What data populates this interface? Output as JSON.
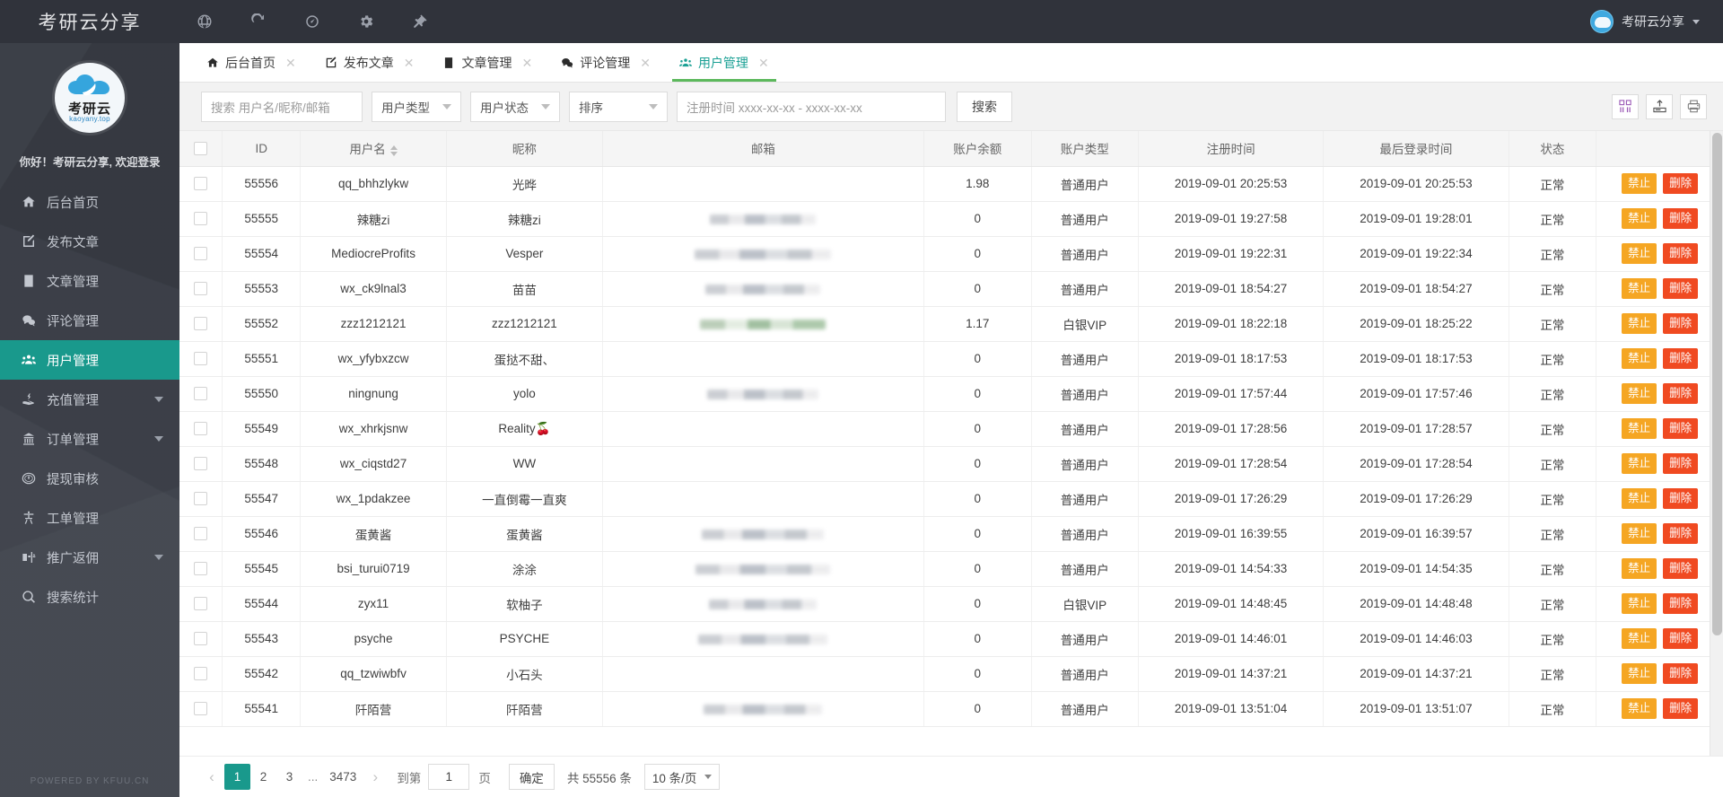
{
  "topbar": {
    "brand": "考研云分享",
    "icons": [
      "globe-icon",
      "refresh-icon",
      "dashboard-icon",
      "gear-icon",
      "pin-icon"
    ],
    "user": "考研云分享"
  },
  "sidebar": {
    "logo_cn": "考研云",
    "logo_url": "kaoyany.top",
    "greeting": "你好！考研云分享, 欢迎登录",
    "powered": "POWERED BY KFUU.CN",
    "items": [
      {
        "label": "后台首页",
        "icon": "home-icon",
        "active": false,
        "arrow": false
      },
      {
        "label": "发布文章",
        "icon": "edit-icon",
        "active": false,
        "arrow": false
      },
      {
        "label": "文章管理",
        "icon": "doc-icon",
        "active": false,
        "arrow": false
      },
      {
        "label": "评论管理",
        "icon": "comment-icon",
        "active": false,
        "arrow": false
      },
      {
        "label": "用户管理",
        "icon": "users-icon",
        "active": true,
        "arrow": false
      },
      {
        "label": "充值管理",
        "icon": "recharge-icon",
        "active": false,
        "arrow": true
      },
      {
        "label": "订单管理",
        "icon": "order-icon",
        "active": false,
        "arrow": true
      },
      {
        "label": "提现审核",
        "icon": "withdraw-icon",
        "active": false,
        "arrow": false
      },
      {
        "label": "工单管理",
        "icon": "ticket-icon",
        "active": false,
        "arrow": false
      },
      {
        "label": "推广返佣",
        "icon": "promote-icon",
        "active": false,
        "arrow": true
      },
      {
        "label": "搜索统计",
        "icon": "search-icon",
        "active": false,
        "arrow": false
      }
    ]
  },
  "tabs": [
    {
      "label": "后台首页",
      "icon": "home-icon",
      "active": false
    },
    {
      "label": "发布文章",
      "icon": "edit-icon",
      "active": false
    },
    {
      "label": "文章管理",
      "icon": "doc-icon",
      "active": false
    },
    {
      "label": "评论管理",
      "icon": "comment-icon",
      "active": false
    },
    {
      "label": "用户管理",
      "icon": "users-icon",
      "active": true
    }
  ],
  "toolbar": {
    "search_placeholder": "搜索 用户名/昵称/邮箱",
    "search_value": "",
    "user_type": "用户类型",
    "user_status": "用户状态",
    "sort": "排序",
    "date_placeholder": "注册时间 xxxx-xx-xx - xxxx-xx-xx",
    "date_value": "",
    "search_button": "搜索",
    "right_icons": [
      "columns-icon",
      "export-icon",
      "print-icon"
    ]
  },
  "table": {
    "columns": [
      "",
      "ID",
      "用户名",
      "昵称",
      "邮箱",
      "账户余额",
      "账户类型",
      "注册时间",
      "最后登录时间",
      "状态",
      ""
    ],
    "sortable_column": "用户名",
    "ban_label": "禁止",
    "delete_label": "删除",
    "rows": [
      {
        "id": "55556",
        "username": "qq_bhhzlykw",
        "nickname": "光晔",
        "mail_w": 0,
        "mail_green": false,
        "balance": "1.98",
        "type": "普通用户",
        "reg": "2019-09-01 20:25:53",
        "login": "2019-09-01 20:25:53",
        "status": "正常"
      },
      {
        "id": "55555",
        "username": "辣糖zi",
        "nickname": "辣糖zi",
        "mail_w": 118,
        "mail_green": false,
        "balance": "0",
        "type": "普通用户",
        "reg": "2019-09-01 19:27:58",
        "login": "2019-09-01 19:28:01",
        "status": "正常"
      },
      {
        "id": "55554",
        "username": "MediocreProfits",
        "nickname": "Vesper",
        "mail_w": 152,
        "mail_green": false,
        "balance": "0",
        "type": "普通用户",
        "reg": "2019-09-01 19:22:31",
        "login": "2019-09-01 19:22:34",
        "status": "正常"
      },
      {
        "id": "55553",
        "username": "wx_ck9lnal3",
        "nickname": "苗苗",
        "mail_w": 128,
        "mail_green": false,
        "balance": "0",
        "type": "普通用户",
        "reg": "2019-09-01 18:54:27",
        "login": "2019-09-01 18:54:27",
        "status": "正常"
      },
      {
        "id": "55552",
        "username": "zzz1212121",
        "nickname": "zzz1212121",
        "mail_w": 140,
        "mail_green": true,
        "balance": "1.17",
        "type": "白银VIP",
        "reg": "2019-09-01 18:22:18",
        "login": "2019-09-01 18:25:22",
        "status": "正常"
      },
      {
        "id": "55551",
        "username": "wx_yfybxzcw",
        "nickname": "蛋挞不甜、",
        "mail_w": 0,
        "mail_green": false,
        "balance": "0",
        "type": "普通用户",
        "reg": "2019-09-01 18:17:53",
        "login": "2019-09-01 18:17:53",
        "status": "正常"
      },
      {
        "id": "55550",
        "username": "ningnung",
        "nickname": "yolo",
        "mail_w": 124,
        "mail_green": false,
        "balance": "0",
        "type": "普通用户",
        "reg": "2019-09-01 17:57:44",
        "login": "2019-09-01 17:57:46",
        "status": "正常"
      },
      {
        "id": "55549",
        "username": "wx_xhrkjsnw",
        "nickname": "Reality🍒",
        "mail_w": 0,
        "mail_green": false,
        "balance": "0",
        "type": "普通用户",
        "reg": "2019-09-01 17:28:56",
        "login": "2019-09-01 17:28:57",
        "status": "正常"
      },
      {
        "id": "55548",
        "username": "wx_ciqstd27",
        "nickname": "WW",
        "mail_w": 0,
        "mail_green": false,
        "balance": "0",
        "type": "普通用户",
        "reg": "2019-09-01 17:28:54",
        "login": "2019-09-01 17:28:54",
        "status": "正常"
      },
      {
        "id": "55547",
        "username": "wx_1pdakzee",
        "nickname": "一直倒霉一直爽",
        "mail_w": 0,
        "mail_green": false,
        "balance": "0",
        "type": "普通用户",
        "reg": "2019-09-01 17:26:29",
        "login": "2019-09-01 17:26:29",
        "status": "正常"
      },
      {
        "id": "55546",
        "username": "蛋黄酱",
        "nickname": "蛋黄酱",
        "mail_w": 136,
        "mail_green": false,
        "balance": "0",
        "type": "普通用户",
        "reg": "2019-09-01 16:39:55",
        "login": "2019-09-01 16:39:57",
        "status": "正常"
      },
      {
        "id": "55545",
        "username": "bsi_turui0719",
        "nickname": "涂涂",
        "mail_w": 150,
        "mail_green": false,
        "balance": "0",
        "type": "普通用户",
        "reg": "2019-09-01 14:54:33",
        "login": "2019-09-01 14:54:35",
        "status": "正常"
      },
      {
        "id": "55544",
        "username": "zyx11",
        "nickname": "软柚子",
        "mail_w": 120,
        "mail_green": false,
        "balance": "0",
        "type": "白银VIP",
        "reg": "2019-09-01 14:48:45",
        "login": "2019-09-01 14:48:48",
        "status": "正常"
      },
      {
        "id": "55543",
        "username": "psyche",
        "nickname": "PSYCHE",
        "mail_w": 144,
        "mail_green": false,
        "balance": "0",
        "type": "普通用户",
        "reg": "2019-09-01 14:46:01",
        "login": "2019-09-01 14:46:03",
        "status": "正常"
      },
      {
        "id": "55542",
        "username": "qq_tzwiwbfv",
        "nickname": "小石头",
        "mail_w": 0,
        "mail_green": false,
        "balance": "0",
        "type": "普通用户",
        "reg": "2019-09-01 14:37:21",
        "login": "2019-09-01 14:37:21",
        "status": "正常"
      },
      {
        "id": "55541",
        "username": "阡陌营",
        "nickname": "阡陌营",
        "mail_w": 132,
        "mail_green": false,
        "balance": "0",
        "type": "普通用户",
        "reg": "2019-09-01 13:51:04",
        "login": "2019-09-01 13:51:07",
        "status": "正常"
      }
    ]
  },
  "pagination": {
    "pages": [
      "1",
      "2",
      "3"
    ],
    "current": "1",
    "ellipsis": "...",
    "last_page": "3473",
    "goto_label": "到第",
    "goto_value": "1",
    "page_unit": "页",
    "confirm": "确定",
    "total": "共 55556 条",
    "page_size": "10 条/页"
  },
  "colors": {
    "accent": "#19998c",
    "tab_underline": "#5cb85c",
    "ban": "#f5a623",
    "delete": "#f04a21",
    "sidebar": "#40444d",
    "topbar": "#30333b"
  }
}
